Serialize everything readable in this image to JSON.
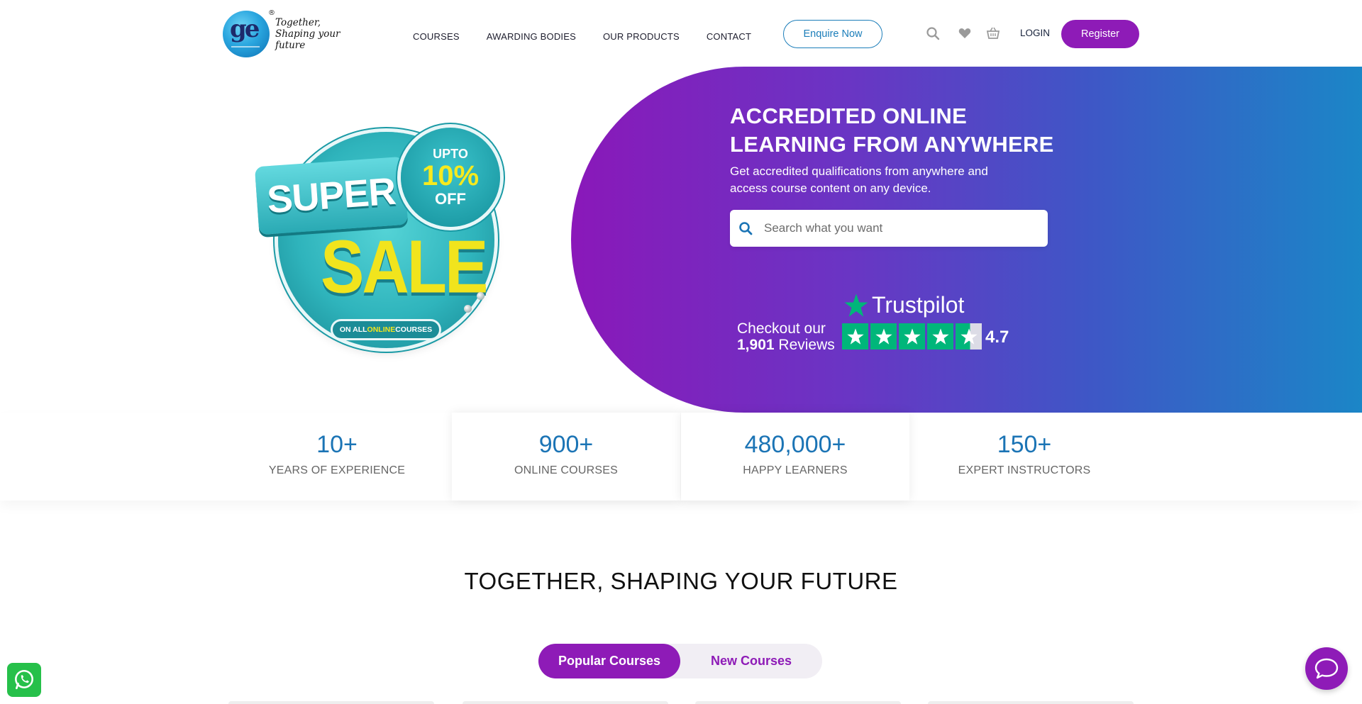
{
  "brand": {
    "tagline_line1": "Together,",
    "tagline_line2": "Shaping your future",
    "registered_mark": "®",
    "accent_color": "#8e1bb7",
    "link_color": "#1b7db9"
  },
  "nav": {
    "items": [
      {
        "label": "COURSES"
      },
      {
        "label": "AWARDING BODIES"
      },
      {
        "label": "OUR PRODUCTS"
      },
      {
        "label": "CONTACT"
      }
    ],
    "enquire_label": "Enquire Now",
    "login_label": "LOGIN",
    "register_label": "Register",
    "icons": [
      "search-icon",
      "heart-icon",
      "basket-icon"
    ]
  },
  "hero": {
    "promo": {
      "super": "SUPER",
      "upto": "UPTO",
      "percent": "10%",
      "off": "OFF",
      "sale": "SALE",
      "pill_prefix": "ON ALL ",
      "pill_highlight": "ONLINE",
      "pill_suffix": " COURSES"
    },
    "title": "ACCREDITED ONLINE LEARNING FROM ANYWHERE",
    "subtitle": "Get accredited qualifications from anywhere and access course content on any device.",
    "search_placeholder": "Search what you want",
    "trustpilot": {
      "checkout_text": "Checkout our",
      "review_count": "1,901",
      "reviews_word": "Reviews",
      "brand": "Trustpilot",
      "score": "4.7",
      "stars": 4.5,
      "star_color": "#00b67a"
    }
  },
  "stats": [
    {
      "value": "10+",
      "label": "YEARS OF EXPERIENCE"
    },
    {
      "value": "900+",
      "label": "ONLINE COURSES"
    },
    {
      "value": "480,000+",
      "label": "HAPPY LEARNERS"
    },
    {
      "value": "150+",
      "label": "EXPERT INSTRUCTORS"
    }
  ],
  "section": {
    "title": "TOGETHER, SHAPING YOUR FUTURE",
    "tabs": [
      {
        "label": "Popular Courses",
        "active": true
      },
      {
        "label": "New Courses",
        "active": false
      }
    ]
  },
  "widgets": {
    "whatsapp_icon": "whatsapp-icon",
    "chat_icon": "chat-bubble-icon"
  }
}
